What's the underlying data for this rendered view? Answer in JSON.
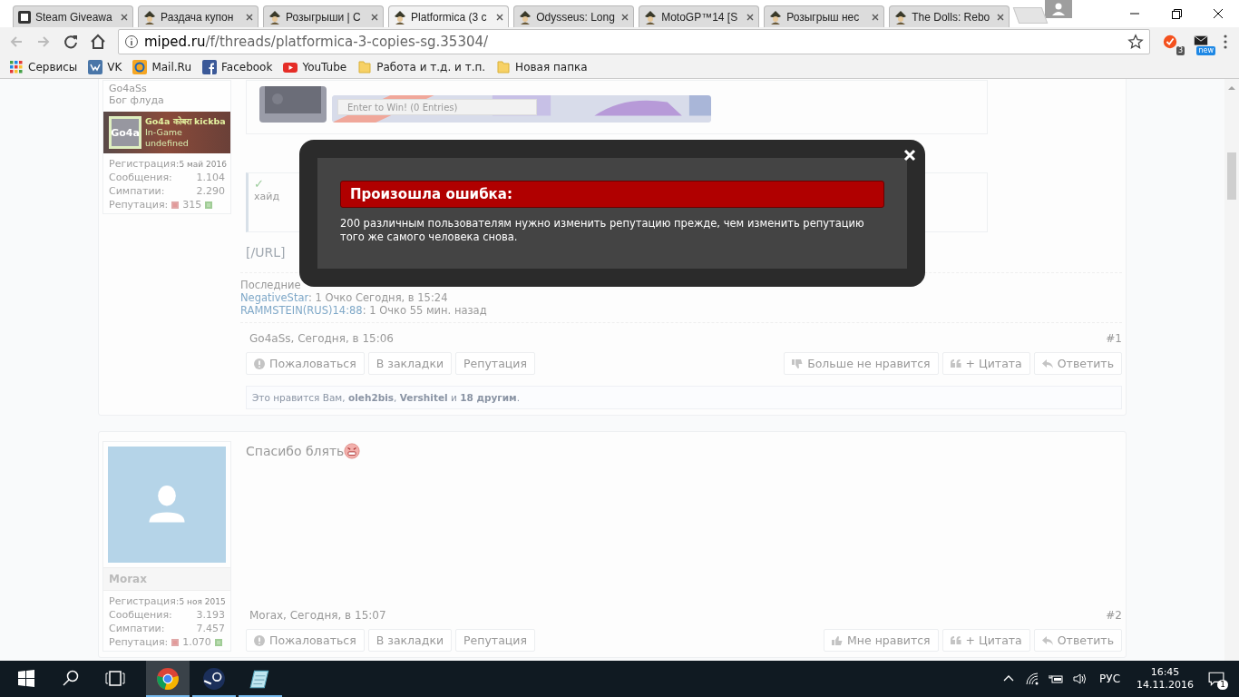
{
  "browser": {
    "tabs": [
      {
        "title": "Steam Giveawa",
        "kind": "square",
        "selected": false
      },
      {
        "title": "Раздача купон",
        "kind": "figure",
        "selected": false
      },
      {
        "title": "Розыгрыши | С",
        "kind": "figure",
        "selected": false
      },
      {
        "title": "Platformica (3 c",
        "kind": "figure",
        "selected": true
      },
      {
        "title": "Odysseus: Long",
        "kind": "figure",
        "selected": false
      },
      {
        "title": "MotoGP™14 [S",
        "kind": "figure",
        "selected": false
      },
      {
        "title": "Розыгрыш нес",
        "kind": "figure",
        "selected": false
      },
      {
        "title": "The Dolls: Rebo",
        "kind": "figure",
        "selected": false
      }
    ],
    "url_host": "miped.ru",
    "url_path": "/f/threads/platformica-3-copies-sg.35304/",
    "extension_badges": [
      "3",
      "new"
    ],
    "bookmarks": [
      {
        "label": "Сервисы",
        "kind": "apps"
      },
      {
        "label": "VK",
        "kind": "vk"
      },
      {
        "label": "Mail.Ru",
        "kind": "mail"
      },
      {
        "label": "Facebook",
        "kind": "facebook"
      },
      {
        "label": "YouTube",
        "kind": "youtube"
      },
      {
        "label": "Работа и т.д. и т.п.",
        "kind": "folder"
      },
      {
        "label": "Новая папка",
        "kind": "folder"
      }
    ]
  },
  "posts": [
    {
      "author": "Go4aSs",
      "user_title": "Бог флуда",
      "steam": {
        "logo": "Go4a",
        "name": "Go4a कोबरा kickba",
        "status": "In-Game",
        "game": "undefined"
      },
      "stats": [
        {
          "label": "Регистрация:",
          "value": "5 май 2016",
          "kind": "date"
        },
        {
          "label": "Сообщения:",
          "value": "1.104",
          "kind": "count"
        },
        {
          "label": "Симпатии:",
          "value": "2.290",
          "kind": "count"
        }
      ],
      "reputation": {
        "label": "Репутация:",
        "value": "315"
      },
      "giveaway": {
        "button": "Enter to Win!",
        "entries": "(0 Entries)"
      },
      "hide": {
        "mark": "✓",
        "text": "хайд"
      },
      "tail": "[/URL]",
      "rep_heading": "Последние",
      "rep_entries": [
        {
          "user": "NegativeStar",
          "text": ": 1 Очко Сегодня, в 15:24"
        },
        {
          "user": "RAMMSTEIN(RUS)14:88",
          "text": ": 1 Очко 55 мин. назад"
        }
      ],
      "meta": "Go4aSs, Сегодня, в 15:06",
      "number": "#1",
      "actions_left": [
        {
          "label": "Пожаловаться",
          "kind": "report"
        },
        {
          "label": "В закладки",
          "kind": "plain"
        },
        {
          "label": "Репутация",
          "kind": "plain"
        }
      ],
      "actions_right": [
        {
          "label": "Больше не нравится",
          "kind": "unlike"
        },
        {
          "label": "+ Цитата",
          "kind": "quote"
        },
        {
          "label": "Ответить",
          "kind": "reply"
        }
      ],
      "likes": "Это нравится Вам, **oleh2bis**, **Vershitel** и **18 другим**."
    },
    {
      "author": "Morax",
      "stats": [
        {
          "label": "Регистрация:",
          "value": "5 ноя 2015",
          "kind": "date"
        },
        {
          "label": "Сообщения:",
          "value": "3.193",
          "kind": "count"
        },
        {
          "label": "Симпатии:",
          "value": "7.457",
          "kind": "count"
        }
      ],
      "reputation": {
        "label": "Репутация:",
        "value": "1.070"
      },
      "message": "Спасибо блять",
      "meta": "Morax, Сегодня, в 15:07",
      "number": "#2",
      "actions_left": [
        {
          "label": "Пожаловаться",
          "kind": "report"
        },
        {
          "label": "В закладки",
          "kind": "plain"
        },
        {
          "label": "Репутация",
          "kind": "plain"
        }
      ],
      "actions_right": [
        {
          "label": "Мне нравится",
          "kind": "like"
        },
        {
          "label": "+ Цитата",
          "kind": "quote"
        },
        {
          "label": "Ответить",
          "kind": "reply"
        }
      ]
    }
  ],
  "modal": {
    "title": "Произошла ошибка:",
    "message": "200 различным пользователям нужно изменить репутацию прежде, чем изменить репутацию того же самого человека снова."
  },
  "taskbar": {
    "apps": [
      {
        "kind": "chrome",
        "selected": true,
        "running": true
      },
      {
        "kind": "steam",
        "selected": false,
        "running": true
      },
      {
        "kind": "notepad",
        "selected": false,
        "running": true
      }
    ],
    "language": "РУС",
    "time": "16:45",
    "date": "14.11.2016",
    "notifications": "1"
  }
}
